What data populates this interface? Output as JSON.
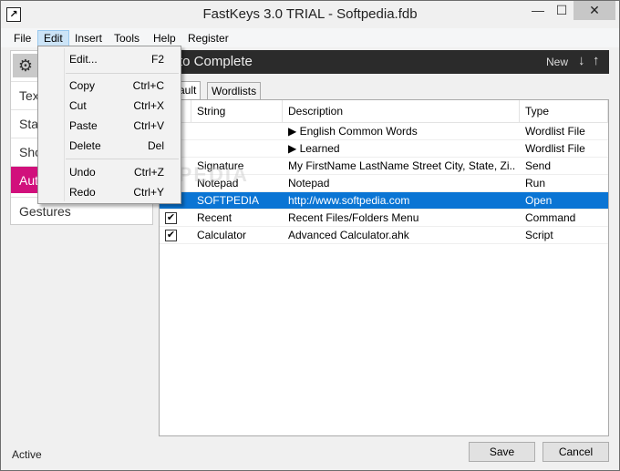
{
  "window": {
    "title": "FastKeys 3.0 TRIAL - Softpedia.fdb",
    "icon_glyph": "↗"
  },
  "title_buttons": {
    "minimize": "—",
    "maximize": "☐",
    "close": "✕"
  },
  "menubar": {
    "file": "File",
    "edit": "Edit",
    "insert": "Insert",
    "tools": "Tools",
    "help": "Help",
    "register": "Register"
  },
  "sidebar": {
    "gear_icon": "⚙",
    "items": [
      {
        "label": "Text"
      },
      {
        "label": "Start"
      },
      {
        "label": "Shortcuts"
      },
      {
        "label": "Auto Complete"
      },
      {
        "label": "Gestures"
      }
    ]
  },
  "panel": {
    "title": "to Complete",
    "new_label": "New",
    "down_arrow": "↓",
    "up_arrow": "↑"
  },
  "tabs": {
    "default": "ault",
    "wordlists": "Wordlists"
  },
  "table": {
    "headers": {
      "on": "n",
      "string": "String",
      "description": "Description",
      "type": "Type"
    },
    "rows": [
      {
        "checked": "",
        "string": "",
        "description": "▶  English Common Words",
        "type": "Wordlist File"
      },
      {
        "checked": "",
        "string": "",
        "description": "▶  Learned",
        "type": "Wordlist File"
      },
      {
        "checked": "",
        "string": "Signature",
        "description": "My FirstName LastName Street City, State, Zi...",
        "type": "Send"
      },
      {
        "checked": "",
        "string": "Notepad",
        "description": "Notepad",
        "type": "Run"
      },
      {
        "checked": "",
        "string": "SOFTPEDIA",
        "description": "http://www.softpedia.com",
        "type": "Open"
      },
      {
        "checked": "✔",
        "string": "Recent",
        "description": "Recent Files/Folders Menu",
        "type": "Command"
      },
      {
        "checked": "✔",
        "string": "Calculator",
        "description": "Advanced Calculator.ahk",
        "type": "Script"
      }
    ]
  },
  "edit_menu": {
    "edit": {
      "label": "Edit...",
      "key": "F2"
    },
    "copy": {
      "label": "Copy",
      "key": "Ctrl+C"
    },
    "cut": {
      "label": "Cut",
      "key": "Ctrl+X"
    },
    "paste": {
      "label": "Paste",
      "key": "Ctrl+V"
    },
    "delete": {
      "label": "Delete",
      "key": "Del"
    },
    "undo": {
      "label": "Undo",
      "key": "Ctrl+Z"
    },
    "redo": {
      "label": "Redo",
      "key": "Ctrl+Y"
    }
  },
  "watermark": "SOFTPEDIA",
  "status": "Active",
  "buttons": {
    "save": "Save",
    "cancel": "Cancel"
  },
  "colors": {
    "accent_selected_sidebar": "#d1107c",
    "row_selected": "#0a75d4",
    "header_dark": "#2b2b2b"
  }
}
